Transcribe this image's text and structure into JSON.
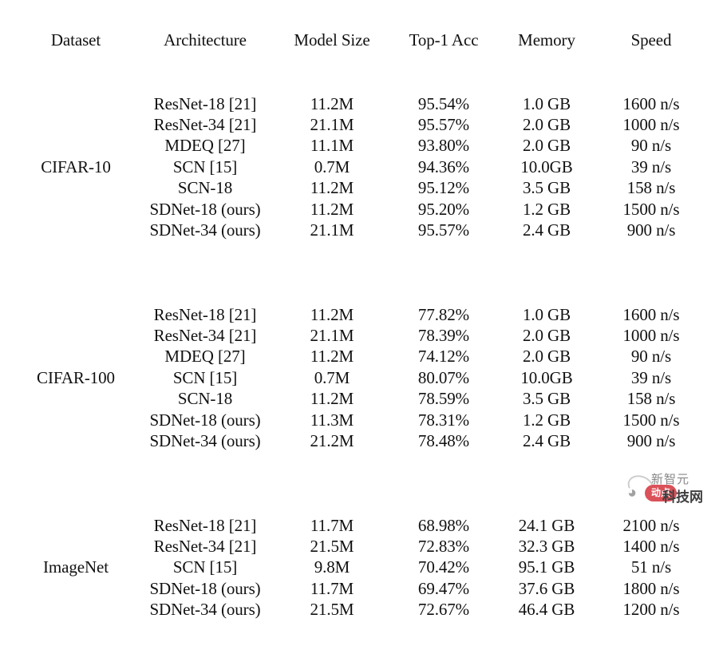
{
  "table": {
    "columns": [
      "Dataset",
      "Architecture",
      "Model Size",
      "Top-1 Acc",
      "Memory",
      "Speed"
    ],
    "sections": [
      {
        "dataset": "CIFAR-10",
        "rows": [
          {
            "architecture": "ResNet-18 [21]",
            "model_size": "11.2M",
            "top1_acc": "95.54%",
            "memory": "1.0 GB",
            "speed": "1600 n/s"
          },
          {
            "architecture": "ResNet-34 [21]",
            "model_size": "21.1M",
            "top1_acc": "95.57%",
            "memory": "2.0 GB",
            "speed": "1000 n/s"
          },
          {
            "architecture": "MDEQ [27]",
            "model_size": "11.1M",
            "top1_acc": "93.80%",
            "memory": "2.0 GB",
            "speed": "90 n/s"
          },
          {
            "architecture": "SCN [15]",
            "model_size": "0.7M",
            "top1_acc": "94.36%",
            "memory": "10.0GB",
            "speed": "39 n/s"
          },
          {
            "architecture": "SCN-18",
            "model_size": "11.2M",
            "top1_acc": "95.12%",
            "memory": "3.5 GB",
            "speed": "158 n/s"
          },
          {
            "architecture": "SDNet-18 (ours)",
            "model_size": "11.2M",
            "top1_acc": "95.20%",
            "memory": "1.2 GB",
            "speed": "1500 n/s"
          },
          {
            "architecture": "SDNet-34 (ours)",
            "model_size": "21.1M",
            "top1_acc": "95.57%",
            "memory": "2.4 GB",
            "speed": "900 n/s"
          }
        ]
      },
      {
        "dataset": "CIFAR-100",
        "rows": [
          {
            "architecture": "ResNet-18 [21]",
            "model_size": "11.2M",
            "top1_acc": "77.82%",
            "memory": "1.0 GB",
            "speed": "1600 n/s"
          },
          {
            "architecture": "ResNet-34 [21]",
            "model_size": "21.1M",
            "top1_acc": "78.39%",
            "memory": "2.0 GB",
            "speed": "1000 n/s"
          },
          {
            "architecture": "MDEQ [27]",
            "model_size": "11.2M",
            "top1_acc": "74.12%",
            "memory": "2.0 GB",
            "speed": "90 n/s"
          },
          {
            "architecture": "SCN [15]",
            "model_size": "0.7M",
            "top1_acc": "80.07%",
            "memory": "10.0GB",
            "speed": "39 n/s"
          },
          {
            "architecture": "SCN-18",
            "model_size": "11.2M",
            "top1_acc": "78.59%",
            "memory": "3.5 GB",
            "speed": "158 n/s"
          },
          {
            "architecture": "SDNet-18 (ours)",
            "model_size": "11.3M",
            "top1_acc": "78.31%",
            "memory": "1.2 GB",
            "speed": "1500 n/s"
          },
          {
            "architecture": "SDNet-34 (ours)",
            "model_size": "21.2M",
            "top1_acc": "78.48%",
            "memory": "2.4 GB",
            "speed": "900 n/s"
          }
        ]
      },
      {
        "dataset": "ImageNet",
        "rows": [
          {
            "architecture": "ResNet-18 [21]",
            "model_size": "11.7M",
            "top1_acc": "68.98%",
            "memory": "24.1 GB",
            "speed": "2100 n/s"
          },
          {
            "architecture": "ResNet-34 [21]",
            "model_size": "21.5M",
            "top1_acc": "72.83%",
            "memory": "32.3 GB",
            "speed": "1400 n/s"
          },
          {
            "architecture": "SCN [15]",
            "model_size": "9.8M",
            "top1_acc": "70.42%",
            "memory": "95.1 GB",
            "speed": "51 n/s"
          },
          {
            "architecture": "SDNet-18 (ours)",
            "model_size": "11.7M",
            "top1_acc": "69.47%",
            "memory": "37.6 GB",
            "speed": "1800 n/s"
          },
          {
            "architecture": "SDNet-34 (ours)",
            "model_size": "21.5M",
            "top1_acc": "72.67%",
            "memory": "46.4 GB",
            "speed": "1200 n/s"
          }
        ]
      }
    ]
  },
  "watermark": {
    "top_text": "新智元",
    "badge_text": "动点",
    "bottom_text": "科技网"
  }
}
